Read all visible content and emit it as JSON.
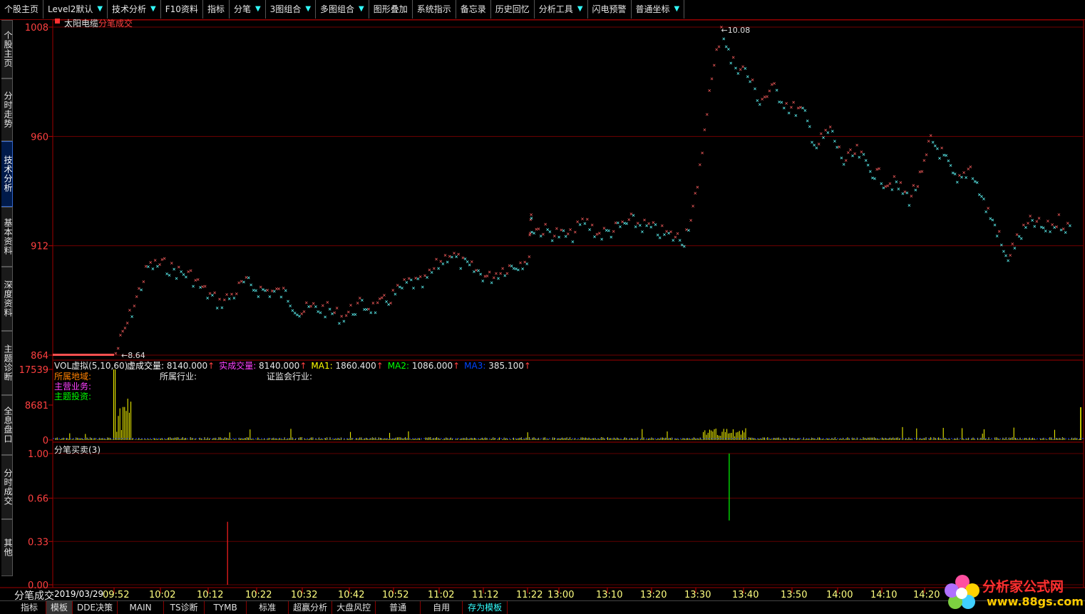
{
  "toolbar": [
    {
      "label": "个股主页",
      "dd": false
    },
    {
      "label": "Level2默认",
      "dd": true
    },
    {
      "label": "技术分析",
      "dd": true
    },
    {
      "label": "F10资料",
      "dd": false
    },
    {
      "label": "指标",
      "dd": false
    },
    {
      "label": "分笔",
      "dd": true
    },
    {
      "label": "3图组合",
      "dd": true
    },
    {
      "label": "多图组合",
      "dd": true
    },
    {
      "label": "图形叠加",
      "dd": false
    },
    {
      "label": "系统指示",
      "dd": false
    },
    {
      "label": "备忘录",
      "dd": false
    },
    {
      "label": "历史回忆",
      "dd": false
    },
    {
      "label": "分析工具",
      "dd": true
    },
    {
      "label": "闪电预警",
      "dd": false
    },
    {
      "label": "普通坐标",
      "dd": true
    }
  ],
  "side_tabs": [
    "个股主页",
    "分时走势",
    "技术分析",
    "基本资料",
    "深度资料",
    "主题诊断",
    "全息盘口",
    "分时成交",
    "其他"
  ],
  "active_side_tab": 2,
  "price_panel": {
    "stock_name": "太阳电缆",
    "chart_name": "分笔成交",
    "y_ticks": [
      "1008",
      "960",
      "912",
      "864"
    ],
    "y_tick_values": [
      1008,
      960,
      912,
      864
    ],
    "high_label": "10.08",
    "low_label": "8.64"
  },
  "vol_panel": {
    "title": "VOL虚拟(5,10,60)",
    "legend": [
      {
        "label": "虚成交量:",
        "value": "8140.000",
        "color": "#ffffff"
      },
      {
        "label": "实成交量:",
        "value": "8140.000",
        "color": "#ff40ff"
      },
      {
        "label": "MA1:",
        "value": "1860.400",
        "color": "#ffff00"
      },
      {
        "label": "MA2:",
        "value": "1086.000",
        "color": "#00ff00"
      },
      {
        "label": "MA3:",
        "value": "385.100",
        "color": "#0044ff"
      }
    ],
    "info_labels": [
      {
        "text": "所属地域:",
        "color": "#ff8000"
      },
      {
        "text": "主营业务:",
        "color": "#ff40ff"
      },
      {
        "text": "主题投资:",
        "color": "#00ff00"
      }
    ],
    "industry": "所属行业:",
    "csrc": "证监会行业:",
    "y_ticks": [
      "17539",
      "8681",
      "0"
    ],
    "y_tick_values": [
      17539,
      8681,
      0
    ]
  },
  "bs_panel": {
    "title": "分笔买卖(3)",
    "y_ticks": [
      "1.00",
      "0.66",
      "0.33",
      "0.00"
    ],
    "y_tick_values": [
      1.0,
      0.66,
      0.33,
      0.0
    ],
    "bars": [
      {
        "time": "10:16",
        "value": 0.48,
        "color": "#ff2020"
      },
      {
        "time": "13:37",
        "value": 0.51,
        "color": "#00ff00",
        "from": 1.0
      }
    ]
  },
  "x_axis": {
    "date": "2019/03/29",
    "ticks": [
      "09:52",
      "10:02",
      "10:12",
      "10:22",
      "10:32",
      "10:42",
      "10:52",
      "11:02",
      "11:12",
      "11:22",
      "13:00",
      "13:10",
      "13:20",
      "13:30",
      "13:40",
      "13:50",
      "14:00",
      "14:10",
      "14:20"
    ]
  },
  "bottom_tabs": [
    {
      "label": "指标",
      "cls": ""
    },
    {
      "label": "模板",
      "cls": "sel"
    },
    {
      "label": "DDE决策",
      "cls": ""
    },
    {
      "label": "MAIN",
      "cls": ""
    },
    {
      "label": "TS诊断",
      "cls": ""
    },
    {
      "label": "TYMB",
      "cls": ""
    },
    {
      "label": "标准",
      "cls": ""
    },
    {
      "label": "超赢分析",
      "cls": ""
    },
    {
      "label": "大盘风控",
      "cls": ""
    },
    {
      "label": "普通",
      "cls": ""
    },
    {
      "label": "自用",
      "cls": ""
    },
    {
      "label": "存为模板",
      "cls": "cyan"
    }
  ],
  "corner_label": "分笔成交",
  "logo": {
    "title": "分析家公式网",
    "url": "www.88gs.com"
  },
  "chart_data": {
    "type": "scatter",
    "title": "分笔成交",
    "x_unit": "time",
    "y_unit": "price",
    "anchor_points": [
      {
        "t": "09:52",
        "p": 8.64
      },
      {
        "t": "09:55",
        "p": 8.8
      },
      {
        "t": "09:59",
        "p": 9.02
      },
      {
        "t": "10:02",
        "p": 9.03
      },
      {
        "t": "10:05",
        "p": 9.0
      },
      {
        "t": "10:08",
        "p": 8.98
      },
      {
        "t": "10:11",
        "p": 8.91
      },
      {
        "t": "10:14",
        "p": 8.86
      },
      {
        "t": "10:17",
        "p": 8.9
      },
      {
        "t": "10:19",
        "p": 8.95
      },
      {
        "t": "10:22",
        "p": 8.92
      },
      {
        "t": "10:25",
        "p": 8.91
      },
      {
        "t": "10:28",
        "p": 8.9
      },
      {
        "t": "10:31",
        "p": 8.82
      },
      {
        "t": "10:34",
        "p": 8.84
      },
      {
        "t": "10:37",
        "p": 8.83
      },
      {
        "t": "10:40",
        "p": 8.8
      },
      {
        "t": "10:44",
        "p": 8.85
      },
      {
        "t": "10:48",
        "p": 8.84
      },
      {
        "t": "10:52",
        "p": 8.9
      },
      {
        "t": "10:55",
        "p": 8.95
      },
      {
        "t": "10:58",
        "p": 8.94
      },
      {
        "t": "11:01",
        "p": 9.02
      },
      {
        "t": "11:04",
        "p": 9.08
      },
      {
        "t": "11:07",
        "p": 9.03
      },
      {
        "t": "11:10",
        "p": 9.0
      },
      {
        "t": "11:13",
        "p": 8.97
      },
      {
        "t": "11:16",
        "p": 9.01
      },
      {
        "t": "11:19",
        "p": 9.03
      },
      {
        "t": "11:22",
        "p": 9.06
      },
      {
        "t": "11:25",
        "p": 9.2
      },
      {
        "t": "11:28",
        "p": 9.26
      },
      {
        "t": "11:30",
        "p": 9.19
      },
      {
        "t": "13:02",
        "p": 9.15
      },
      {
        "t": "13:05",
        "p": 9.22
      },
      {
        "t": "13:08",
        "p": 9.16
      },
      {
        "t": "13:11",
        "p": 9.18
      },
      {
        "t": "13:15",
        "p": 9.22
      },
      {
        "t": "13:19",
        "p": 9.19
      },
      {
        "t": "13:23",
        "p": 9.16
      },
      {
        "t": "13:27",
        "p": 9.14
      },
      {
        "t": "13:30",
        "p": 9.35
      },
      {
        "t": "13:32",
        "p": 9.72
      },
      {
        "t": "13:34",
        "p": 9.95
      },
      {
        "t": "13:35",
        "p": 10.08
      },
      {
        "t": "13:37",
        "p": 9.92
      },
      {
        "t": "13:40",
        "p": 9.88
      },
      {
        "t": "13:43",
        "p": 9.75
      },
      {
        "t": "13:46",
        "p": 9.8
      },
      {
        "t": "13:49",
        "p": 9.72
      },
      {
        "t": "13:52",
        "p": 9.7
      },
      {
        "t": "13:55",
        "p": 9.55
      },
      {
        "t": "13:58",
        "p": 9.62
      },
      {
        "t": "14:01",
        "p": 9.48
      },
      {
        "t": "14:04",
        "p": 9.52
      },
      {
        "t": "14:07",
        "p": 9.45
      },
      {
        "t": "14:10",
        "p": 9.4
      },
      {
        "t": "14:13",
        "p": 9.38
      },
      {
        "t": "14:16",
        "p": 9.32
      },
      {
        "t": "14:19",
        "p": 9.42
      },
      {
        "t": "14:21",
        "p": 9.58
      },
      {
        "t": "14:24",
        "p": 9.5
      },
      {
        "t": "14:27",
        "p": 9.38
      },
      {
        "t": "14:30",
        "p": 9.46
      },
      {
        "t": "14:33",
        "p": 9.3
      },
      {
        "t": "14:36",
        "p": 9.18
      },
      {
        "t": "14:38",
        "p": 9.05
      },
      {
        "t": "14:41",
        "p": 9.15
      },
      {
        "t": "14:44",
        "p": 9.22
      },
      {
        "t": "14:47",
        "p": 9.18
      },
      {
        "t": "14:50",
        "p": 9.22
      },
      {
        "t": "14:53",
        "p": 9.18
      }
    ],
    "colors": {
      "up": "#ff6060",
      "down": "#60ffff",
      "vol": "#ffff00",
      "grid": "#800000"
    }
  }
}
